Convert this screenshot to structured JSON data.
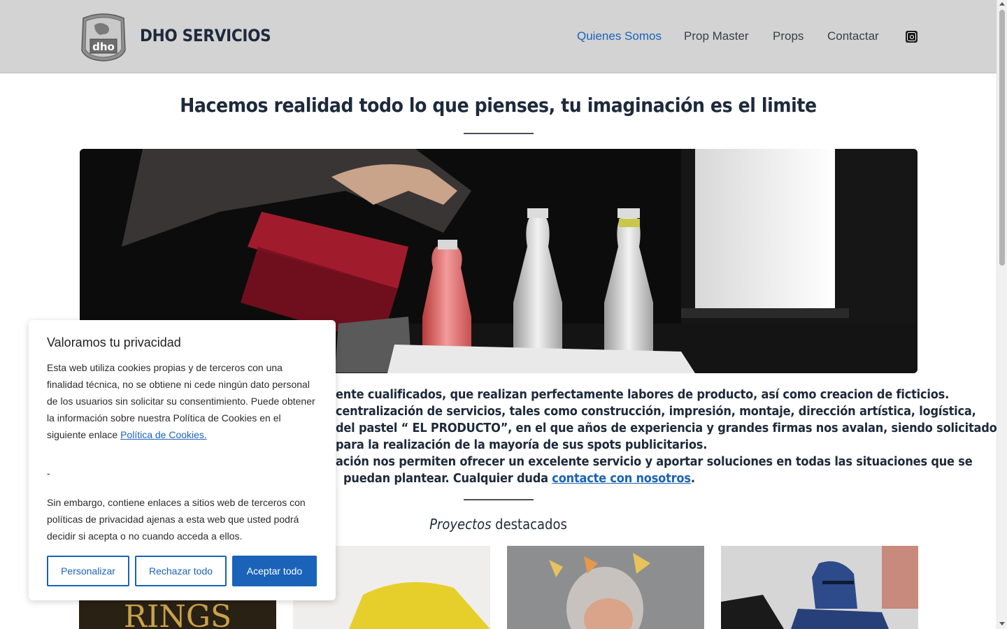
{
  "header": {
    "brand": "DHO SERVICIOS",
    "nav": [
      {
        "label": "Quienes Somos",
        "active": true
      },
      {
        "label": "Prop Master",
        "active": false
      },
      {
        "label": "Props",
        "active": false
      },
      {
        "label": "Contactar",
        "active": false
      }
    ],
    "social_icon": "instagram-icon",
    "logo_text": "dho"
  },
  "main": {
    "headline": "Hacemos realidad todo lo que pienses, tu imaginación es el limite",
    "description_lines": [
      "ente cualificados, que realizan perfectamente labores de producto, así como creacion de ficticios.",
      "centralización de servicios, tales como construcción, impresión, montaje, dirección artística, logística,",
      "del pastel “ EL PRODUCTO”,  en el que años de experiencia y  grandes firmas nos avalan, siendo solicitados",
      "para la realización de la mayoría de sus spots publicitarios.",
      "ación nos permiten ofrecer un excelente servicio y aportar soluciones en todas las situaciones que se",
      "puedan plantear. Cualquier duda "
    ],
    "contact_link": "contacte con nosotros",
    "contact_link_suffix": ".",
    "projects_title_em": "Proyectos",
    "projects_title_rest": " destacados",
    "thumb_text": "RINGS"
  },
  "cookie_banner": {
    "title": "Valoramos tu privacidad",
    "paragraph1_lines": [
      "Esta web utiliza cookies propias y de terceros con una",
      "finalidad técnica, no se obtiene ni cede ningún dato personal",
      "de los usuarios sin solicitar su consentimiento. Puede obtener",
      "la información sobre nuestra Política de Cookies en el",
      "siguiente enlace "
    ],
    "policy_link": "Política de Cookies.",
    "dash": "-",
    "paragraph2_lines": [
      "Sin embargo, contiene enlaces a sitios web de terceros con",
      "políticas de privacidad ajenas a esta web que usted podrá",
      "decidir si acepta o no cuando acceda a ellos."
    ],
    "buttons": {
      "customize": "Personalizar",
      "reject": "Rechazar todo",
      "accept": "Aceptar todo"
    },
    "accent_color": "#1a63b8"
  }
}
